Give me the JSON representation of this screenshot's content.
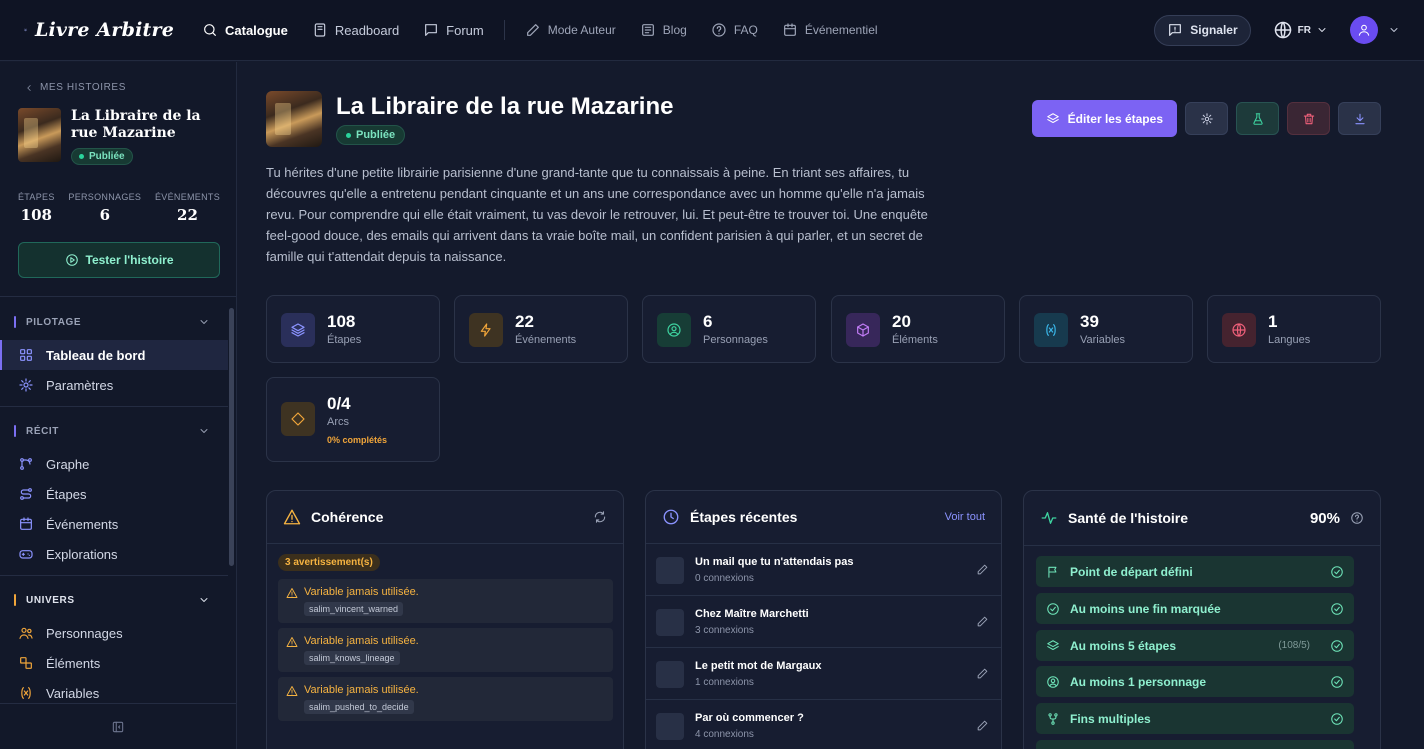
{
  "nav": {
    "logo": "Livre Arbitre",
    "items": [
      {
        "label": "Catalogue",
        "icon": "search-icon",
        "active": true
      },
      {
        "label": "Readboard",
        "icon": "book-icon"
      },
      {
        "label": "Forum",
        "icon": "chat-icon"
      }
    ],
    "secondary": [
      {
        "label": "Mode Auteur",
        "icon": "pen-icon"
      },
      {
        "label": "Blog",
        "icon": "newspaper-icon"
      },
      {
        "label": "FAQ",
        "icon": "help-icon"
      },
      {
        "label": "Événementiel",
        "icon": "calendar-icon"
      }
    ],
    "report": "Signaler",
    "lang": "FR"
  },
  "sidebar": {
    "back": "MES HISTOIRES",
    "story_title": "La Libraire de la rue Mazarine",
    "status": "Publiée",
    "stats": [
      {
        "label": "ÉTAPES",
        "value": "108"
      },
      {
        "label": "PERSONNAGES",
        "value": "6"
      },
      {
        "label": "ÉVÉNEMENTS",
        "value": "22"
      }
    ],
    "test_button": "Tester l'histoire",
    "sections": [
      {
        "title": "PILOTAGE",
        "color": "#7b6ff2",
        "items": [
          {
            "label": "Tableau de bord",
            "icon": "dashboard-icon",
            "active": true
          },
          {
            "label": "Paramètres",
            "icon": "gear-icon"
          }
        ]
      },
      {
        "title": "RÉCIT",
        "color": "#7b6ff2",
        "items": [
          {
            "label": "Graphe",
            "icon": "graph-icon"
          },
          {
            "label": "Étapes",
            "icon": "route-icon"
          },
          {
            "label": "Événements",
            "icon": "calendar-icon"
          },
          {
            "label": "Explorations",
            "icon": "gamepad-icon"
          }
        ]
      },
      {
        "title": "UNIVERS",
        "color": "#f0a53a",
        "items": [
          {
            "label": "Personnages",
            "icon": "users-icon"
          },
          {
            "label": "Éléments",
            "icon": "shapes-icon"
          },
          {
            "label": "Variables",
            "icon": "variable-icon"
          }
        ]
      }
    ]
  },
  "main": {
    "title": "La Libraire de la rue Mazarine",
    "status": "Publiée",
    "edit_button": "Éditer les étapes",
    "description": "Tu hérites d'une petite librairie parisienne d'une grand-tante que tu connaissais à peine. En triant ses affaires, tu découvres qu'elle a entretenu pendant cinquante et un ans une correspondance avec un homme qu'elle n'a jamais revu. Pour comprendre qui elle était vraiment, tu vas devoir le retrouver, lui. Et peut-être te trouver toi. Une enquête feel-good douce, des emails qui arrivent dans ta vraie boîte mail, un confident parisien à qui parler, et un secret de famille qui t'attendait depuis ta naissance.",
    "stats": [
      {
        "value": "108",
        "label": "Étapes",
        "icon": "layers-icon",
        "color": "#8b93ff",
        "bg": "#2a2f5a"
      },
      {
        "value": "22",
        "label": "Événements",
        "icon": "bolt-icon",
        "color": "#f0a53a",
        "bg": "#3e3322"
      },
      {
        "value": "6",
        "label": "Personnages",
        "icon": "user-circle-icon",
        "color": "#3ed3a0",
        "bg": "#173d36"
      },
      {
        "value": "20",
        "label": "Éléments",
        "icon": "cube-icon",
        "color": "#c07bf5",
        "bg": "#37275a"
      },
      {
        "value": "39",
        "label": "Variables",
        "icon": "variable-icon",
        "color": "#3ab6e8",
        "bg": "#173a4e"
      },
      {
        "value": "1",
        "label": "Langues",
        "icon": "globe-icon",
        "color": "#f0607a",
        "bg": "#45232f"
      },
      {
        "value": "0/4",
        "label": "Arcs",
        "icon": "diamond-icon",
        "color": "#f0a53a",
        "bg": "#3e3322",
        "sub": "0% complétés"
      }
    ],
    "coherence": {
      "title": "Cohérence",
      "count": "3 avertissement(s)",
      "warnings": [
        {
          "text": "Variable jamais utilisée.",
          "code": "salim_vincent_warned"
        },
        {
          "text": "Variable jamais utilisée.",
          "code": "salim_knows_lineage"
        },
        {
          "text": "Variable jamais utilisée.",
          "code": "salim_pushed_to_decide"
        }
      ]
    },
    "recent": {
      "title": "Étapes récentes",
      "see_all": "Voir tout",
      "items": [
        {
          "title": "Un mail que tu n'attendais pas",
          "sub": "0 connexions"
        },
        {
          "title": "Chez Maître Marchetti",
          "sub": "3 connexions"
        },
        {
          "title": "Le petit mot de Margaux",
          "sub": "1 connexions"
        },
        {
          "title": "Par où commencer ?",
          "sub": "4 connexions"
        }
      ]
    },
    "health": {
      "title": "Santé de l'histoire",
      "score": "90%",
      "items": [
        {
          "label": "Point de départ défini",
          "icon": "flag-icon"
        },
        {
          "label": "Au moins une fin marquée",
          "icon": "check-circle-icon"
        },
        {
          "label": "Au moins 5 étapes",
          "icon": "layers-icon",
          "count": "(108/5)"
        },
        {
          "label": "Au moins 1 personnage",
          "icon": "user-circle-icon"
        },
        {
          "label": "Fins multiples",
          "icon": "branch-icon"
        }
      ]
    }
  }
}
